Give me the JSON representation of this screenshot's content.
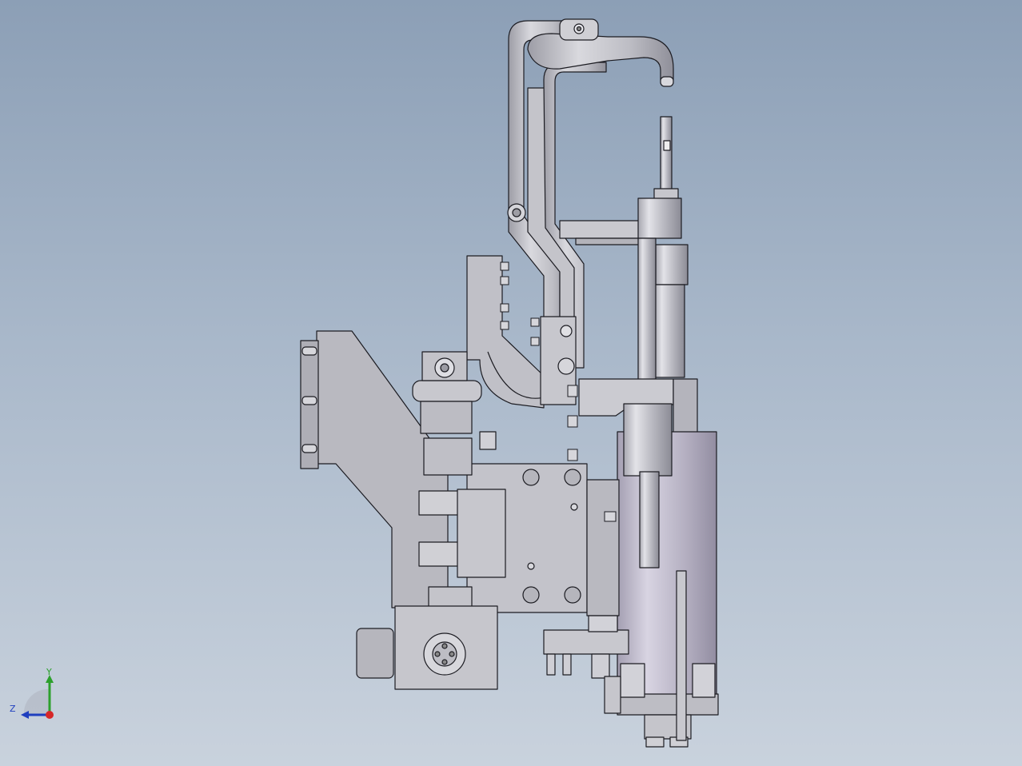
{
  "viewport": {
    "background_top": "#8c9fb6",
    "background_bottom": "#c9d2dd"
  },
  "model": {
    "icon": "cad-assembly-icon",
    "metal_color": "#b9b9c0",
    "edge_color": "#1c1c22"
  },
  "triad": {
    "y_label": "Y",
    "z_label": "Z",
    "y_color": "#2ca02c",
    "x_color": "#d62728",
    "z_color": "#1f3fbf"
  }
}
